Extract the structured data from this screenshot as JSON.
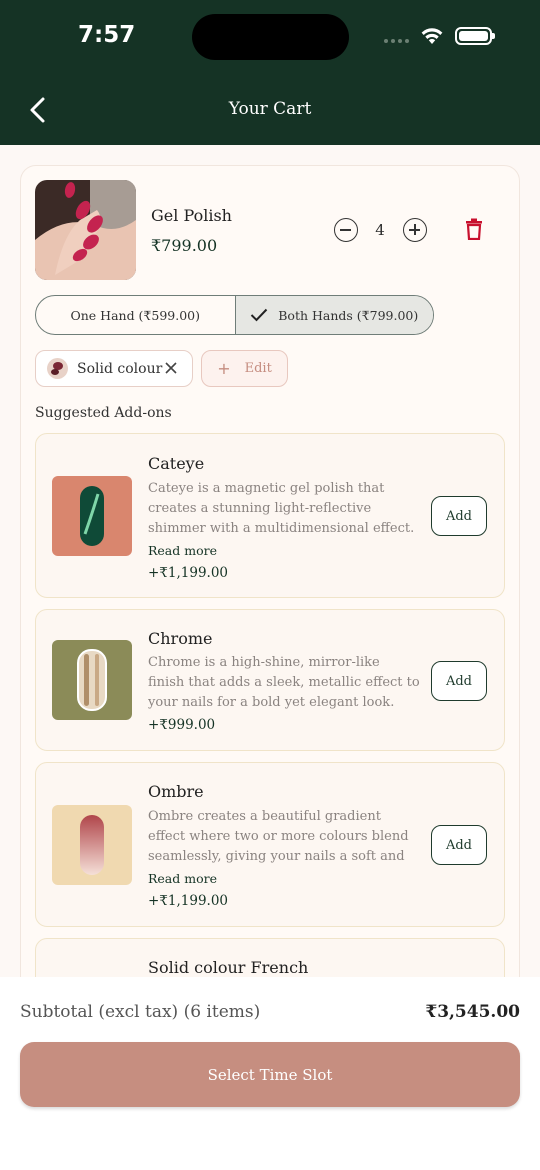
{
  "status_bar": {
    "time": "7:57"
  },
  "header": {
    "title": "Your Cart"
  },
  "cart_item": {
    "name": "Gel Polish",
    "price": "₹799.00",
    "quantity": "4",
    "options": [
      {
        "label": "One Hand (₹599.00)",
        "selected": false
      },
      {
        "label": "Both Hands (₹799.00)",
        "selected": true
      }
    ],
    "selected_style": "Solid colour",
    "edit_label": "Edit"
  },
  "addons": {
    "title": "Suggested Add-ons",
    "items": [
      {
        "name": "Cateye",
        "description": " Cateye is a magnetic gel polish that creates a stunning light-reflective shimmer with a multidimensional effect. As your nails cat...",
        "read_more": "Read more",
        "price": "+₹1,199.00",
        "add_label": "Add"
      },
      {
        "name": "Chrome",
        "description": "Chrome is a high-shine, mirror-like finish that adds a sleek, metallic effect to your nails for a bold yet elegant look.",
        "price": "+₹999.00",
        "add_label": "Add"
      },
      {
        "name": "Ombre",
        "description": "Ombre creates a beautiful gradient effect where two or more colours blend seamlessly, giving your nails a soft and ele...",
        "read_more": "Read more",
        "price": "+₹1,199.00",
        "add_label": "Add"
      },
      {
        "name": "Solid colour French"
      }
    ]
  },
  "footer": {
    "subtotal_label": "Subtotal (excl tax) (6 items)",
    "subtotal_value": "₹3,545.00",
    "cta_label": "Select Time Slot"
  },
  "colors": {
    "header_bg": "#153325",
    "accent": "#c68e80",
    "delete": "#c8102e"
  }
}
